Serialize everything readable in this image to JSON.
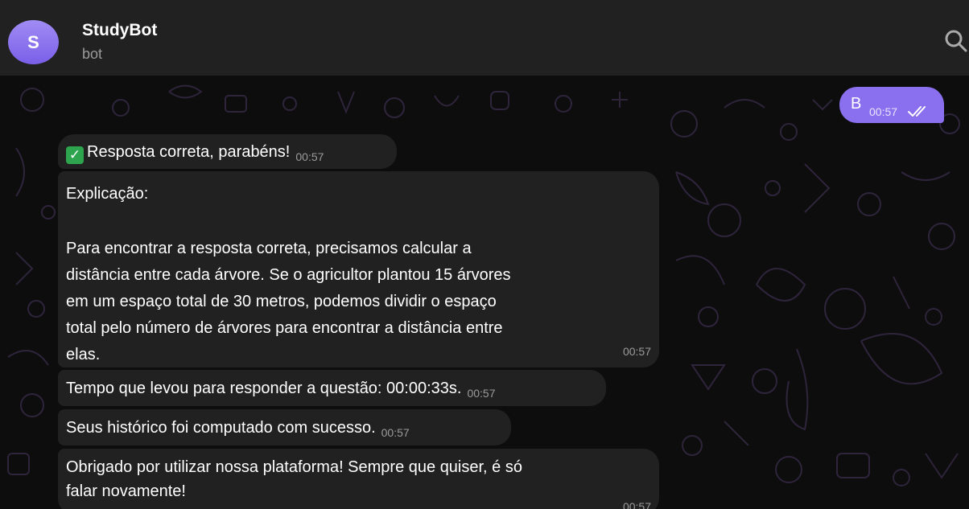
{
  "header": {
    "avatar_letter": "S",
    "title": "StudyBot",
    "subtitle": "bot"
  },
  "outgoing": {
    "text": "B",
    "time": "00:57",
    "status_icon": "double-check-icon"
  },
  "messages": [
    {
      "text": "Resposta correta, parabéns!",
      "time": "00:57",
      "emoji": "✓"
    },
    {
      "lines": [
        "Explicação:",
        "",
        "Para encontrar a resposta correta, precisamos calcular a",
        "distância entre cada árvore. Se o agricultor plantou 15 árvores",
        "em um espaço total de 30 metros, podemos dividir o espaço",
        "total pelo número de árvores para encontrar a distância entre",
        "elas."
      ],
      "time": "00:57"
    },
    {
      "text": "Tempo que levou para responder a questão: 00:00:33s.",
      "time": "00:57"
    },
    {
      "text": "Seus histórico foi computado com sucesso.",
      "time": "00:57"
    },
    {
      "lines": [
        "Obrigado por utilizar nossa plataforma! Sempre que quiser, é só",
        "falar novamente!"
      ],
      "time": "00:57"
    }
  ],
  "colors": {
    "accent": "#8a6fee",
    "header_bg": "#212121",
    "bubble_bg": "#212121",
    "chat_bg": "#0d0d0e",
    "emoji_green": "#2ea44f"
  }
}
